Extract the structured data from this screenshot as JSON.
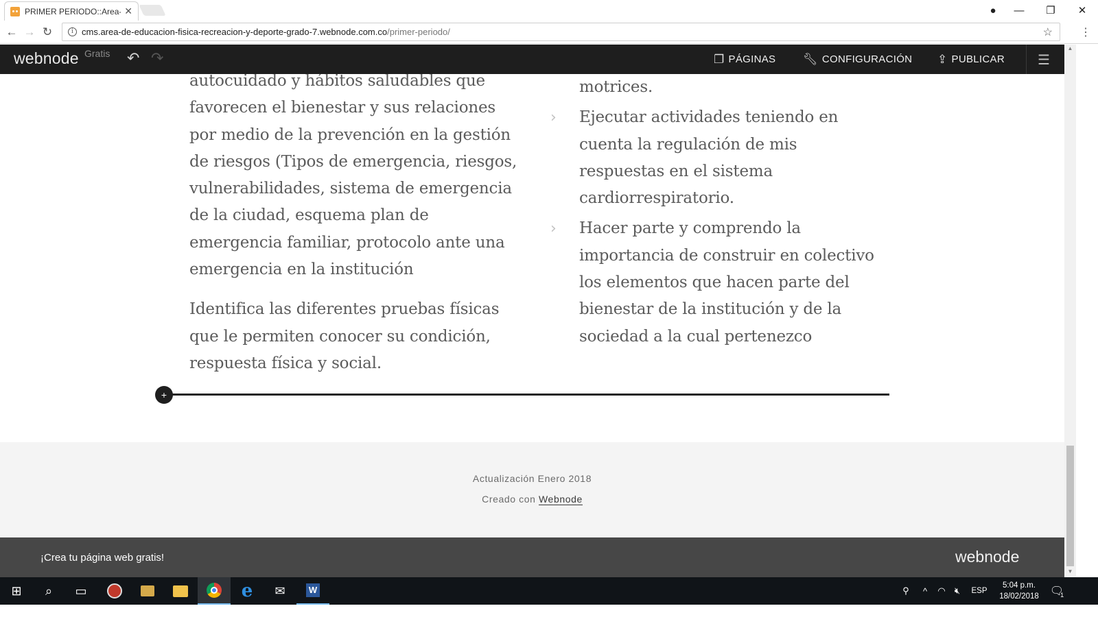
{
  "browser": {
    "tab_title": "PRIMER PERIODO::Area-d",
    "url_host": "cms.area-de-educacion-fisica-recreacion-y-deporte-grado-7.webnode.com.co",
    "url_path": "/primer-periodo/"
  },
  "toolbar": {
    "logo": "webnode",
    "plan": "Gratis",
    "pages_label": "PÁGINAS",
    "config_label": "CONFIGURACIÓN",
    "publish_label": "PUBLICAR"
  },
  "content": {
    "left_paragraphs": [
      "autocuidado y hábitos saludables que favorecen el bienestar y sus relaciones por medio de la prevención en la gestión de riesgos (Tipos de emergencia, riesgos, vulnerabilidades, sistema de emergencia de la ciudad, esquema plan de emergencia familiar, protocolo ante una emergencia en la institución",
      "Identifica las diferentes pruebas físicas que le permiten conocer su condición, respuesta física y social."
    ],
    "right_continuation": "motrices.",
    "right_bullets": [
      "Ejecutar actividades teniendo en cuenta la regulación de mis respuestas en el sistema cardiorrespiratorio.",
      "Hacer parte y comprendo la importancia de construir en colectivo los elementos que hacen parte del bienestar de la institución y de la sociedad a la cual pertenezco"
    ]
  },
  "footer": {
    "update_text": "Actualización Enero 2018",
    "created_prefix": "Creado con",
    "created_link": "Webnode"
  },
  "promo": {
    "text": "¡Crea tu página web gratis!",
    "logo": "webnode"
  },
  "taskbar": {
    "language": "ESP",
    "time": "5:04 p.m.",
    "date": "18/02/2018",
    "notifications": "1"
  }
}
